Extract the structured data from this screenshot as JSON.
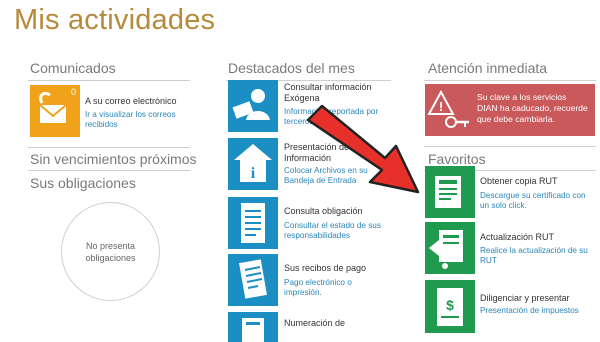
{
  "title": "Mis actividades",
  "col1": {
    "comunicados": {
      "heading": "Comunicados",
      "badge": "0",
      "label": "A su correo electrónico",
      "link": "Ir a visualizar los correos recibidos"
    },
    "sin_vencimientos": "Sin vencimientos próximos",
    "sus_obligaciones": "Sus obligaciones",
    "empty_text": "No presenta obligaciones"
  },
  "col2": {
    "heading": "Destacados del mes",
    "items": [
      {
        "label": "Consultar información Exógena",
        "link": "Información reportada por terceros",
        "icon": "person-document-icon"
      },
      {
        "label": "Presentación de Información",
        "link": "Colocar Archivos en su Bandeja de Entrada",
        "icon": "info-house-icon"
      },
      {
        "label": "Consulta obligación",
        "link": "Consultar el estado de sus responsabilidades",
        "icon": "document-list-icon"
      },
      {
        "label": "Sus recibos de pago",
        "link": "Pago electrónico o impresión.",
        "icon": "receipt-icon"
      },
      {
        "label": "Numeración de",
        "link": "",
        "icon": "numbering-icon"
      }
    ]
  },
  "col3": {
    "atencion_heading": "Atención inmediata",
    "alert_text": "Su clave a los servicios DIAN ha caducado, recuerde que debe cambiarla.",
    "favoritos_heading": "Favoritos",
    "favorites": [
      {
        "label": "Obtener copia RUT",
        "link": "Descargue su certificado con un solo click.",
        "icon": "rut-copy-icon"
      },
      {
        "label": "Actualización RUT",
        "link": "Realice la actualización de su RUT",
        "icon": "rut-update-icon"
      },
      {
        "label": "Diligenciar y presentar",
        "link": "Presentación de impuestos",
        "icon": "tax-form-icon"
      }
    ]
  },
  "colors": {
    "title": "#b58a3a",
    "blue": "#1b8fc3",
    "green": "#1f9a4f",
    "orange": "#f0a21a",
    "red_alert": "#c9595a",
    "arrow": "#e8302a",
    "link": "#2a86b8"
  }
}
